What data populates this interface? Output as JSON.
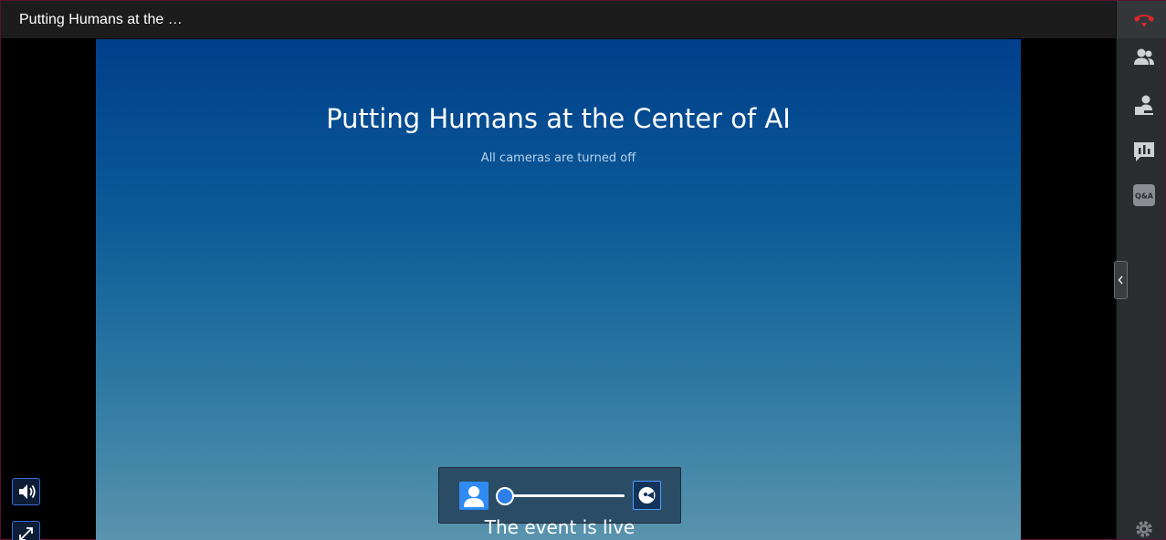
{
  "window": {
    "title": "Putting Humans at the …"
  },
  "stage": {
    "title": "Putting Humans at the Center of AI",
    "subtitle": "All cameras are turned off",
    "status": "The event is live"
  },
  "colors": {
    "hangup_red": "#e0262b",
    "accent_blue": "#2f8bf2",
    "sidebar_bg": "#2a2d30",
    "stage_top": "#003f8c",
    "stage_bottom": "#5a93ad"
  },
  "sidebar": {
    "items": [
      {
        "icon": "hangup-icon"
      },
      {
        "icon": "participants-icon"
      },
      {
        "icon": "presenter-icon"
      },
      {
        "icon": "polls-icon"
      },
      {
        "icon": "qa-icon",
        "label": "Q&A"
      }
    ],
    "settings_icon": "gear-icon"
  },
  "pip_control": {
    "left_icon": "person-icon",
    "right_icon": "screen-share-icon",
    "slider_value": 0
  },
  "player_controls": {
    "volume_icon": "volume-icon",
    "fullscreen_icon": "expand-icon"
  }
}
